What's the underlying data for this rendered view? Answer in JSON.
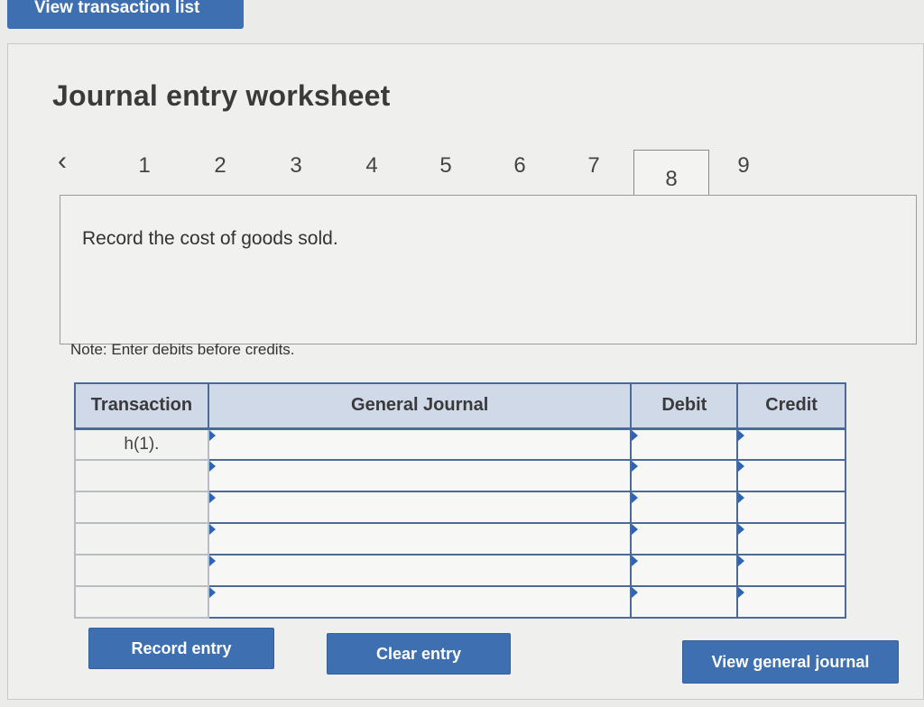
{
  "top_button": {
    "label": "View transaction list"
  },
  "worksheet": {
    "title": "Journal entry worksheet",
    "steps": [
      "1",
      "2",
      "3",
      "4",
      "5",
      "6",
      "7",
      "8",
      "9"
    ],
    "active_step": "8",
    "instruction": "Record the cost of goods sold.",
    "note": "Note: Enter debits before credits."
  },
  "table": {
    "headers": {
      "transaction": "Transaction",
      "general_journal": "General Journal",
      "debit": "Debit",
      "credit": "Credit"
    },
    "rows": [
      {
        "transaction": "h(1)."
      },
      {
        "transaction": ""
      },
      {
        "transaction": ""
      },
      {
        "transaction": ""
      },
      {
        "transaction": ""
      },
      {
        "transaction": ""
      }
    ]
  },
  "buttons": {
    "record_entry": "Record entry",
    "clear_entry": "Clear entry",
    "view_general_journal": "View general journal"
  },
  "icons": {
    "prev": "chevron-left-icon",
    "row_marker": "dropdown-marker-icon"
  },
  "colors": {
    "accent": "#3e6fb0",
    "table_border": "#4b6a95",
    "header_bg": "#cfd9e8"
  }
}
